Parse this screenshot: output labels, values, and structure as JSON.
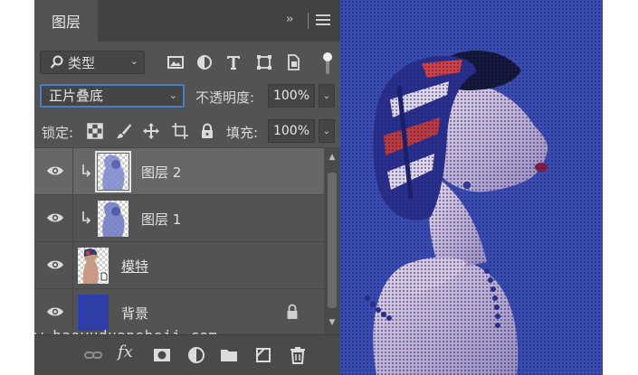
{
  "layers_panel": {
    "tab_title": "图层",
    "collapse_glyph": "››",
    "filter": {
      "kind_label": "类型"
    },
    "blend_mode": "正片叠底",
    "opacity_label": "不透明度:",
    "opacity_value": "100%",
    "lock_label": "锁定:",
    "fill_label": "填充:",
    "fill_value": "100%",
    "layers": [
      {
        "name": "图层 2",
        "selected": true,
        "clipped": true,
        "visible": true
      },
      {
        "name": "图层 1",
        "selected": false,
        "clipped": true,
        "visible": true
      },
      {
        "name": "模特",
        "selected": false,
        "clipped": false,
        "visible": true
      },
      {
        "name": "背景",
        "selected": false,
        "clipped": false,
        "visible": true,
        "locked": true
      }
    ],
    "footer_fx_label": "fx"
  },
  "watermark": "w.haoyuduansheji.com",
  "colors": {
    "panel_bg": "#535353",
    "selected_row": "#676767",
    "accent_blue": "#4a7fc6",
    "background_swatch": "#2f3ea8",
    "photo_bg": "#3a4cb0"
  },
  "icons": {
    "filter": [
      "image-filter-icon",
      "adjustment-filter-icon",
      "type-filter-icon",
      "shape-filter-icon",
      "smart-object-filter-icon"
    ],
    "lock": [
      "lock-transparent-pixels-icon",
      "lock-image-pixels-icon",
      "lock-position-icon",
      "lock-artboard-icon",
      "lock-all-icon"
    ],
    "footer": [
      "link-layers-icon",
      "fx-icon",
      "add-mask-icon",
      "new-adjustment-icon",
      "new-group-icon",
      "new-layer-icon",
      "delete-layer-icon"
    ]
  }
}
